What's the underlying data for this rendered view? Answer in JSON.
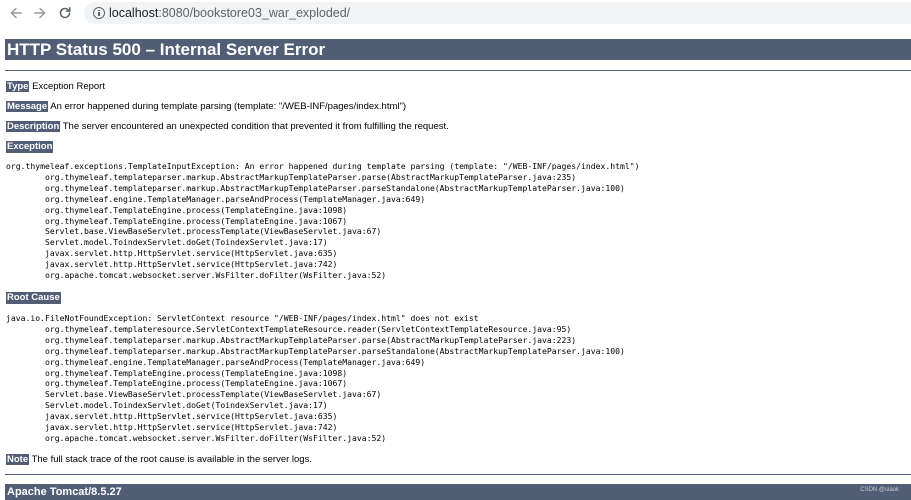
{
  "browser": {
    "url_host": "localhost",
    "url_rest": ":8080/bookstore03_war_exploded/"
  },
  "page": {
    "title": "HTTP Status 500 – Internal Server Error",
    "type_label": "Type",
    "type_value": " Exception Report",
    "message_label": "Message",
    "message_value": " An error happened during template parsing (template: \"/WEB-INF/pages/index.html\")",
    "description_label": "Description",
    "description_value": " The server encountered an unexpected condition that prevented it from fulfilling the request.",
    "exception_label": "Exception",
    "exception_trace": "org.thymeleaf.exceptions.TemplateInputException: An error happened during template parsing (template: \"/WEB-INF/pages/index.html\")\n\torg.thymeleaf.templateparser.markup.AbstractMarkupTemplateParser.parse(AbstractMarkupTemplateParser.java:235)\n\torg.thymeleaf.templateparser.markup.AbstractMarkupTemplateParser.parseStandalone(AbstractMarkupTemplateParser.java:100)\n\torg.thymeleaf.engine.TemplateManager.parseAndProcess(TemplateManager.java:649)\n\torg.thymeleaf.TemplateEngine.process(TemplateEngine.java:1098)\n\torg.thymeleaf.TemplateEngine.process(TemplateEngine.java:1067)\n\tServlet.base.ViewBaseServlet.processTemplate(ViewBaseServlet.java:67)\n\tServlet.model.ToindexServlet.doGet(ToindexServlet.java:17)\n\tjavax.servlet.http.HttpServlet.service(HttpServlet.java:635)\n\tjavax.servlet.http.HttpServlet.service(HttpServlet.java:742)\n\torg.apache.tomcat.websocket.server.WsFilter.doFilter(WsFilter.java:52)",
    "root_cause_label": "Root Cause",
    "root_cause_trace": "java.io.FileNotFoundException: ServletContext resource \"/WEB-INF/pages/index.html\" does not exist\n\torg.thymeleaf.templateresource.ServletContextTemplateResource.reader(ServletContextTemplateResource.java:95)\n\torg.thymeleaf.templateparser.markup.AbstractMarkupTemplateParser.parse(AbstractMarkupTemplateParser.java:223)\n\torg.thymeleaf.templateparser.markup.AbstractMarkupTemplateParser.parseStandalone(AbstractMarkupTemplateParser.java:100)\n\torg.thymeleaf.engine.TemplateManager.parseAndProcess(TemplateManager.java:649)\n\torg.thymeleaf.TemplateEngine.process(TemplateEngine.java:1098)\n\torg.thymeleaf.TemplateEngine.process(TemplateEngine.java:1067)\n\tServlet.base.ViewBaseServlet.processTemplate(ViewBaseServlet.java:67)\n\tServlet.model.ToindexServlet.doGet(ToindexServlet.java:17)\n\tjavax.servlet.http.HttpServlet.service(HttpServlet.java:635)\n\tjavax.servlet.http.HttpServlet.service(HttpServlet.java:742)\n\torg.apache.tomcat.websocket.server.WsFilter.doFilter(WsFilter.java:52)",
    "note_label": "Note",
    "note_value": " The full stack trace of the root cause is available in the server logs.",
    "footer": "Apache Tomcat/8.5.27",
    "watermark": "CSDN @siaok"
  },
  "colors": {
    "header_bg": "#525d76",
    "header_text": "#ffffff"
  },
  "icons": [
    "back-arrow-icon",
    "forward-arrow-icon",
    "reload-icon",
    "info-icon"
  ]
}
